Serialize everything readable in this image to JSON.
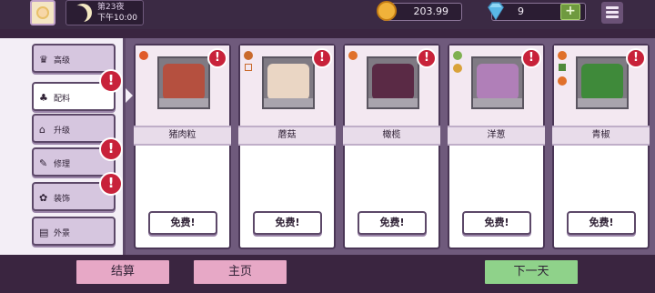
{
  "status": {
    "night": "第23夜",
    "time": "下午10:00"
  },
  "currency": {
    "coins": "203.99",
    "gems": "9",
    "add_label": "+"
  },
  "sidebar": {
    "items": [
      {
        "label": "高级",
        "icon": "crown-icon",
        "glyph": "♛",
        "alert": false
      },
      {
        "label": "配料",
        "icon": "mushroom-icon",
        "glyph": "♣",
        "alert": true,
        "active": true
      },
      {
        "label": "升级",
        "icon": "house-icon",
        "glyph": "⌂",
        "alert": false
      },
      {
        "label": "修理",
        "icon": "wrench-icon",
        "glyph": "✎",
        "alert": true
      },
      {
        "label": "装饰",
        "icon": "plant-pot-icon",
        "glyph": "✿",
        "alert": true
      },
      {
        "label": "外景",
        "icon": "window-icon",
        "glyph": "▤",
        "alert": false
      }
    ],
    "alert_glyph": "!"
  },
  "cards": [
    {
      "name": "猪肉粒",
      "button": "免费!",
      "fill": "#b5503f",
      "tag": "#e05a2a"
    },
    {
      "name": "蘑菇",
      "button": "免费!",
      "fill": "#ead6c4",
      "tag": "#c96a2c"
    },
    {
      "name": "橄榄",
      "button": "免费!",
      "fill": "#5a2a45",
      "tag": "#e0702a"
    },
    {
      "name": "洋葱",
      "button": "免费!",
      "fill": "#b07fb8",
      "tag": "#7fb050"
    },
    {
      "name": "青椒",
      "button": "免费!",
      "fill": "#3f8a3a",
      "tag": "#e0702a"
    }
  ],
  "card_alert_glyph": "!",
  "bottom": {
    "settle": "结算",
    "home": "主页",
    "next_day": "下一天"
  },
  "colors": {
    "alert": "#c8223a",
    "panel": "#6f5a7c",
    "pink_button": "#e7a8c6",
    "green_button": "#8fd28a"
  }
}
